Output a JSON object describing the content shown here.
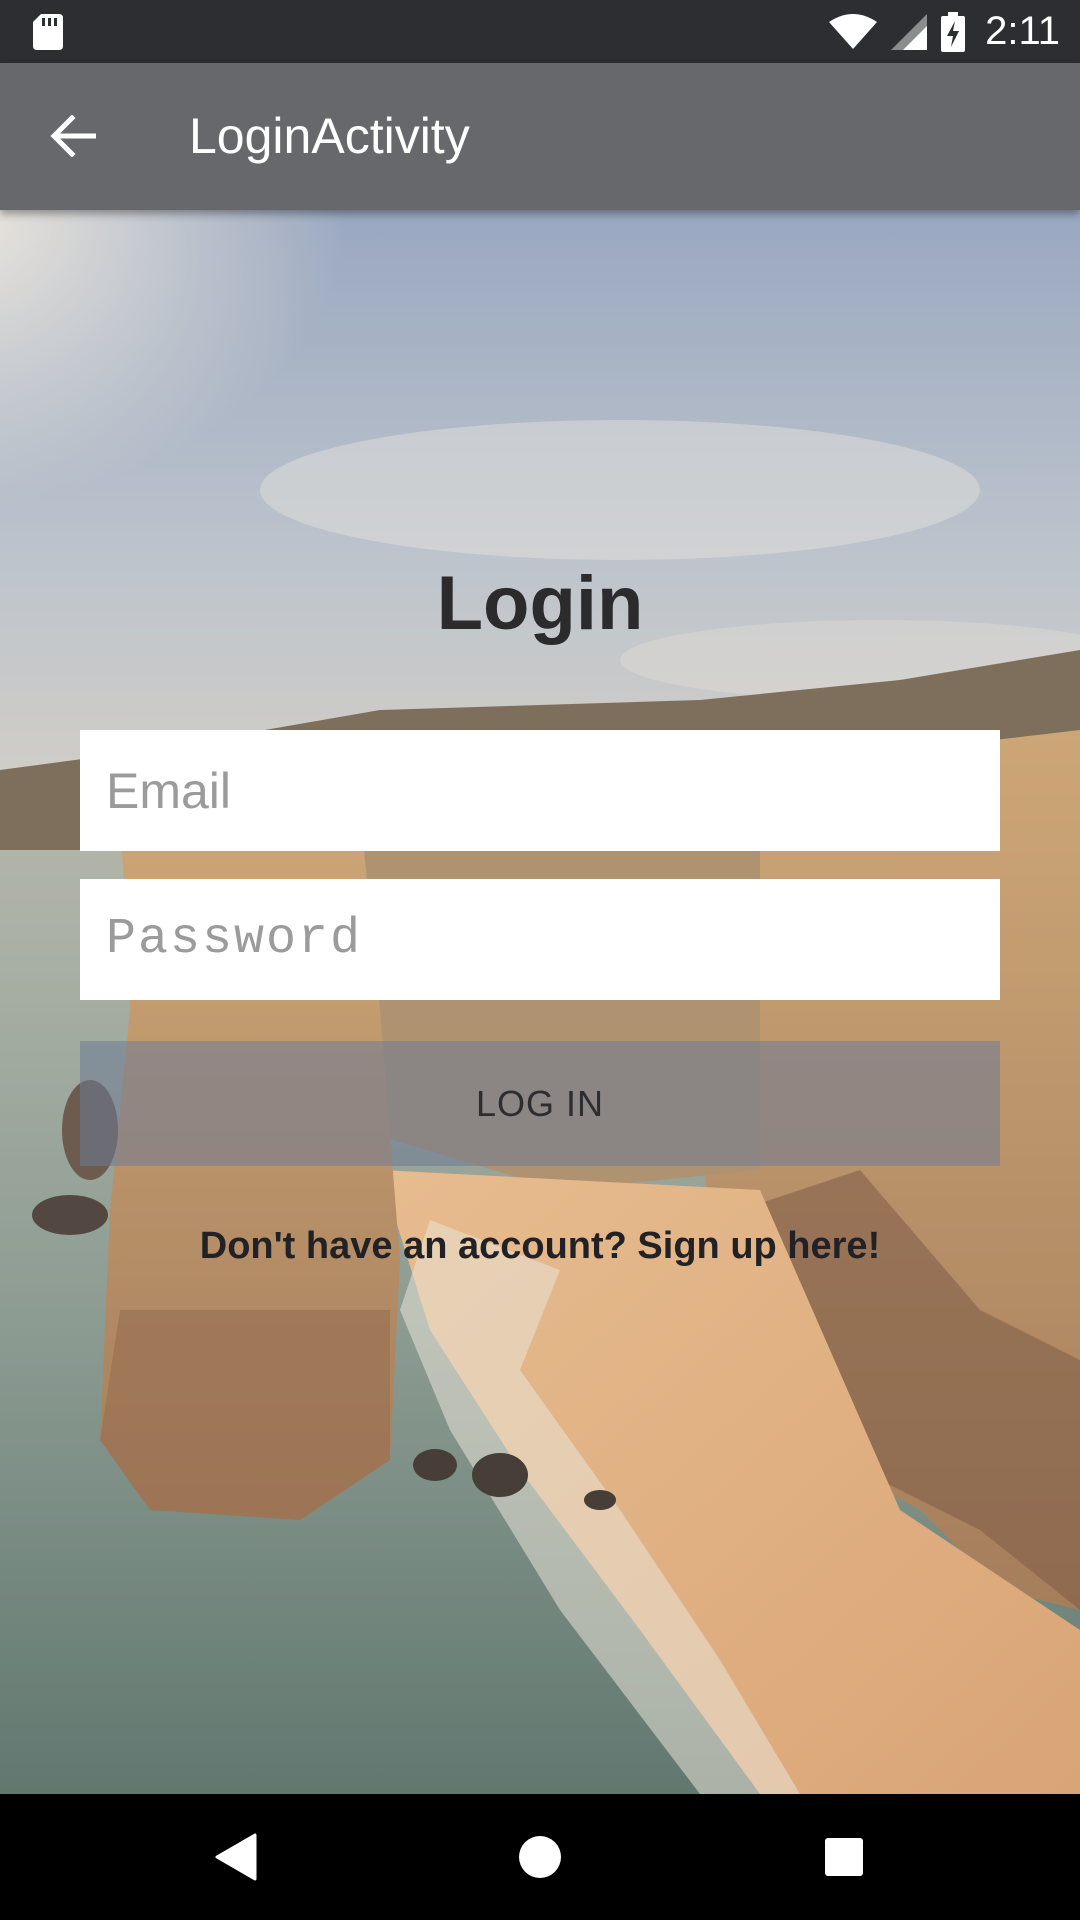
{
  "status_bar": {
    "time": "2:11",
    "icons": [
      "sd-card-icon",
      "wifi-icon",
      "signal-icon",
      "battery-charging-icon"
    ]
  },
  "app_bar": {
    "title": "LoginActivity",
    "back_icon": "arrow-back-icon"
  },
  "login": {
    "title": "Login",
    "email_placeholder": "Email",
    "password_placeholder": "Password",
    "login_button": "LOG IN",
    "signup_text": "Don't have an account? Sign up here!"
  },
  "nav_bar": {
    "icons": [
      "back-triangle-icon",
      "home-circle-icon",
      "recents-square-icon"
    ]
  },
  "colors": {
    "status_bar": "#2c2e32",
    "app_bar": "#66686c",
    "title_text": "#2b2b2d"
  }
}
